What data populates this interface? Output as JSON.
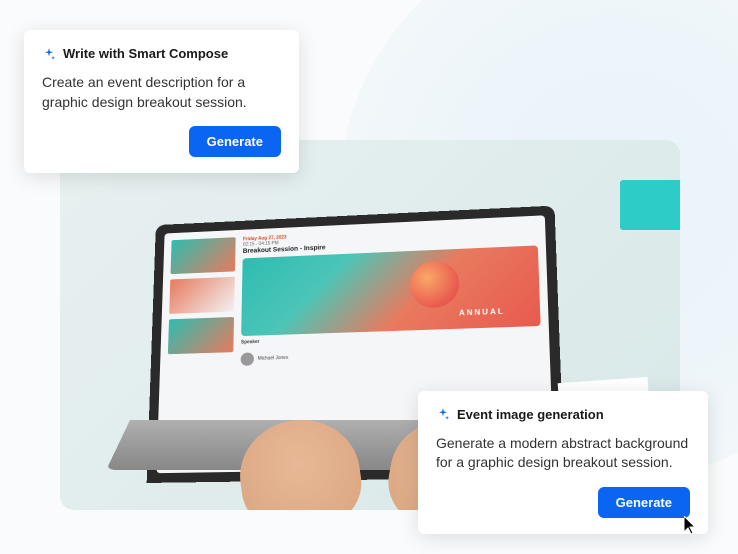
{
  "cards": {
    "compose": {
      "title": "Write with Smart Compose",
      "body": "Create an event description for a graphic design breakout session.",
      "button": "Generate"
    },
    "image_gen": {
      "title": "Event image generation",
      "body": "Generate a modern abstract background for a graphic design breakout session.",
      "button": "Generate"
    }
  },
  "laptop_screen": {
    "date": "Friday Aug 27, 2023",
    "time": "02:15 - 04:15 PM",
    "title": "Breakout Session - Inspire",
    "banner_word": "ANNUAL",
    "speaker_label": "Speaker",
    "speaker_name": "Michael Jones"
  }
}
